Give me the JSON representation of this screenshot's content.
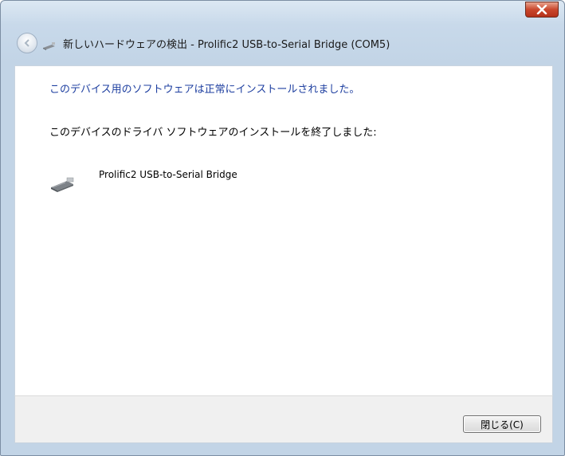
{
  "window": {
    "title": "新しいハードウェアの検出 - Prolific2 USB-to-Serial Bridge (COM5)"
  },
  "titlebar": {
    "close_icon": "close-icon",
    "back_icon": "back-arrow-icon",
    "device_icon": "usb-device-icon"
  },
  "content": {
    "success_message": "このデバイス用のソフトウェアは正常にインストールされました。",
    "completed_message": "このデバイスのドライバ ソフトウェアのインストールを終了しました:",
    "device_name": "Prolific2 USB-to-Serial Bridge",
    "success_color": "#1e3fa0"
  },
  "footer": {
    "close_button_label": "閉じる(C)"
  }
}
